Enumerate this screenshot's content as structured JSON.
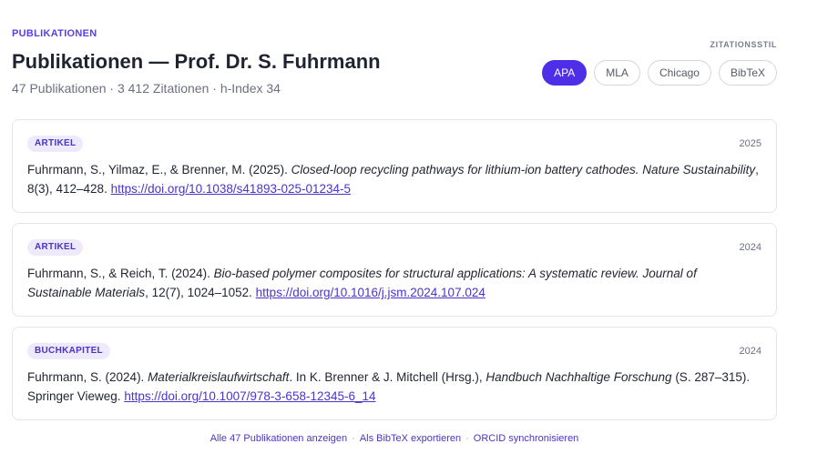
{
  "header": {
    "eyebrow": "PUBLIKATIONEN",
    "title": "Publikationen — Prof. Dr. S. Fuhrmann",
    "stats": "47 Publikationen · 3 412 Zitationen · h-Index 34"
  },
  "citation_style": {
    "label": "ZITATIONSSTIL",
    "options": [
      "APA",
      "MLA",
      "Chicago",
      "BibTeX"
    ],
    "selected": "APA"
  },
  "publications": [
    {
      "type": "ARTIKEL",
      "year": "2025",
      "authors": "Fuhrmann, S., Yilmaz, E., & Brenner, M. (2025). ",
      "title": "Closed-loop recycling pathways for lithium-ion battery cathodes. Nature Sustainability",
      "details": ", 8(3), 412–428. ",
      "doi": "https://doi.org/10.1038/s41893-025-01234-5"
    },
    {
      "type": "ARTIKEL",
      "year": "2024",
      "authors": "Fuhrmann, S., & Reich, T. (2024). ",
      "title": "Bio-based polymer composites for structural applications: A systematic review. Journal of Sustainable Materials",
      "details": ", 12(7), 1024–1052. ",
      "doi": "https://doi.org/10.1016/j.jsm.2024.107.024"
    },
    {
      "type": "BUCHKAPITEL",
      "year": "2024",
      "authors": "Fuhrmann, S. (2024). ",
      "title": "Materialkreislaufwirtschaft",
      "mid": ". In K. Brenner & J. Mitchell (Hrsg.), ",
      "book": "Handbuch Nachhaltige Forschung",
      "details": " (S. 287–315). Springer Vieweg. ",
      "doi": "https://doi.org/10.1007/978-3-658-12345-6_14"
    }
  ],
  "footer": {
    "all_link": "Alle 47 Publikationen anzeigen",
    "bibtex_link": "Als BibTeX exportieren",
    "orcid_link": "ORCID synchronisieren",
    "separator": "·"
  },
  "colors": {
    "accent": "#4f2ee8",
    "badge_bg": "#eeeafc",
    "badge_text": "#4a34c9"
  }
}
